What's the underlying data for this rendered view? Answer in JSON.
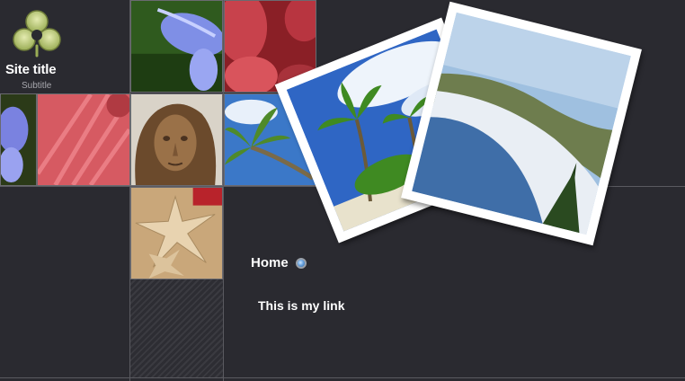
{
  "site": {
    "title": "Site title",
    "subtitle": "Subtitle"
  },
  "nav": {
    "home_label": "Home"
  },
  "content": {
    "link_text": "This is my link"
  },
  "colors": {
    "background": "#2a2a30",
    "grid_line": "#5a5a60",
    "accent_blue": "#6aa4e0",
    "logo_green": "#b9c97a"
  },
  "icons": {
    "logo": "clover-logo-icon",
    "nav_indicator": "radio-dot-icon"
  }
}
